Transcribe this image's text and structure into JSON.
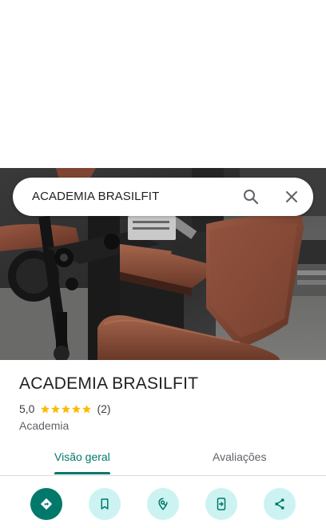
{
  "search": {
    "query": "ACADEMIA BRASILFIT",
    "search_icon": "search-icon",
    "clear_icon": "close-icon"
  },
  "place": {
    "name": "ACADEMIA BRASILFIT",
    "rating": "5,0",
    "stars": 5,
    "review_count": "(2)",
    "category": "Academia"
  },
  "tabs": [
    {
      "label": "Visão geral",
      "selected": true
    },
    {
      "label": "Avaliações",
      "selected": false
    }
  ],
  "actions": [
    {
      "icon": "directions-icon"
    },
    {
      "icon": "bookmark-icon"
    },
    {
      "icon": "nearby-icon"
    },
    {
      "icon": "send-to-phone-icon"
    },
    {
      "icon": "share-icon"
    }
  ],
  "colors": {
    "accent": "#00796b",
    "action_bg": "#ccf3f2",
    "star": "#fbbc04",
    "text": "#202124",
    "muted": "#5f6368"
  }
}
